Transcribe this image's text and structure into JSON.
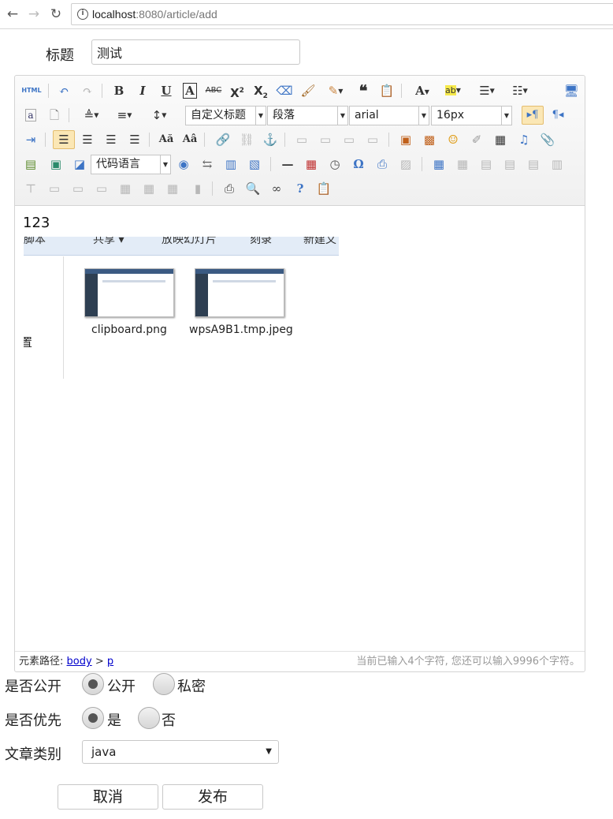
{
  "browser": {
    "url_host": "localhost",
    "url_path": ":8080/article/add"
  },
  "form": {
    "title_label": "标题",
    "title_value": "测试",
    "public_label": "是否公开",
    "public_options": [
      "公开",
      "私密"
    ],
    "priority_label": "是否优先",
    "priority_options": [
      "是",
      "否"
    ],
    "category_label": "文章类别",
    "category_value": "java",
    "cancel_label": "取消",
    "publish_label": "发布"
  },
  "toolbar": {
    "html_label": "HTML",
    "custom_heading": "自定义标题",
    "paragraph": "段落",
    "font_family": "arial",
    "font_size": "16px",
    "code_language": "代码语言"
  },
  "editor": {
    "content_text": "123",
    "pasted_ribbon": [
      "脚本",
      "共享 ▾",
      "放映幻灯片",
      "刻录",
      "新建文"
    ],
    "pasted_files": [
      "clipboard.png",
      "wpsA9B1.tmp.jpeg"
    ],
    "pasted_side_label": "置"
  },
  "statusbar": {
    "path_label": "元素路径:",
    "path_body": "body",
    "path_sep": ">",
    "path_p": "p",
    "word_count": "当前已输入4个字符, 您还可以输入9996个字符。"
  },
  "colors": {
    "accent": "#3d74c5",
    "link": "#0000cc",
    "active_button": "#fbe7b5"
  }
}
